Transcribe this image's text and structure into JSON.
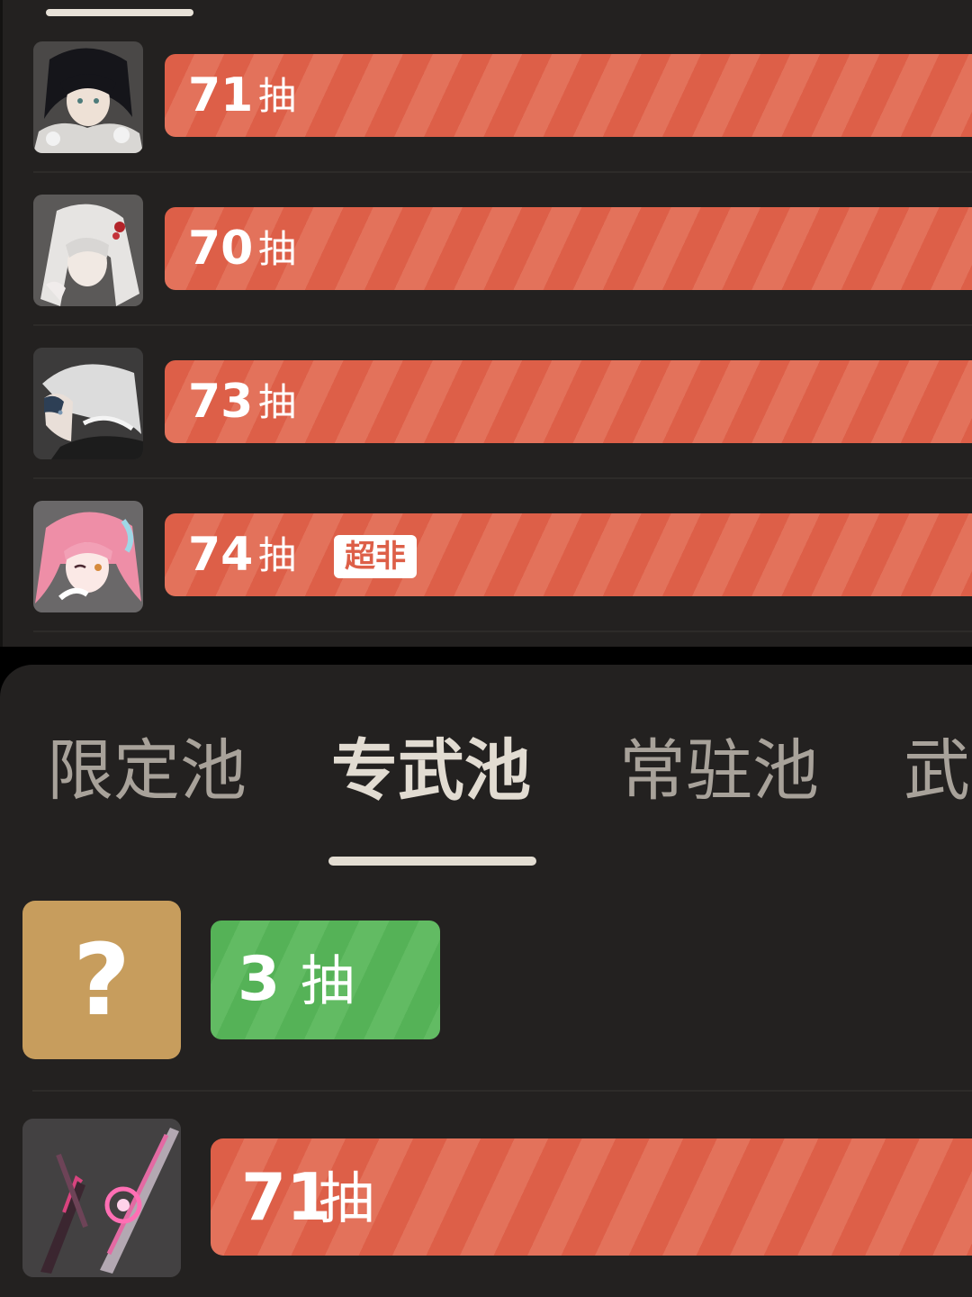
{
  "top_list": {
    "unit_label": "抽",
    "rows": [
      {
        "count": "71",
        "badge": null,
        "avatar": "character-portrait-dark-hair"
      },
      {
        "count": "70",
        "badge": null,
        "avatar": "character-portrait-white-ponytail"
      },
      {
        "count": "73",
        "badge": null,
        "avatar": "character-portrait-silver-hair"
      },
      {
        "count": "74",
        "badge": "超非",
        "avatar": "character-portrait-pink-hair"
      }
    ],
    "bar_color": "#dd5f48"
  },
  "tabs": [
    {
      "label": "限定池",
      "active": false
    },
    {
      "label": "专武池",
      "active": true
    },
    {
      "label": "常驻池",
      "active": false
    },
    {
      "label": "武",
      "active": false
    }
  ],
  "weapon_list": {
    "pending": {
      "icon_text": "?",
      "count": "3",
      "unit": "抽",
      "color": "#55b257"
    },
    "item": {
      "count": "71",
      "unit": "抽",
      "thumb": "weapon-blade",
      "color": "#dd5f48"
    }
  }
}
